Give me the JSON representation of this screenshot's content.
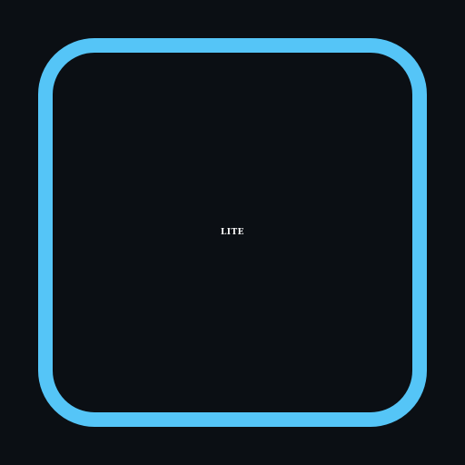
{
  "badge": {
    "label": "LITE"
  },
  "colors": {
    "background": "#0b0f14",
    "frame": "#55c5f7",
    "text": "#ffffff"
  }
}
